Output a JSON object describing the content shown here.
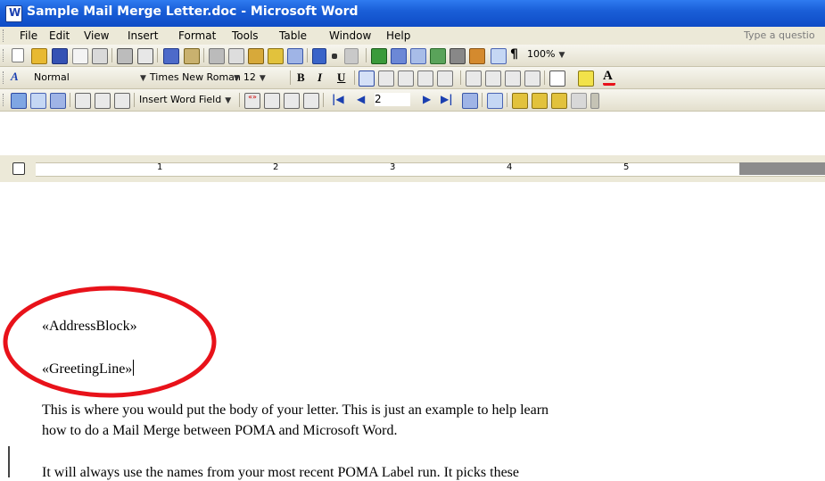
{
  "window": {
    "title": "Sample Mail Merge Letter.doc - Microsoft Word"
  },
  "menu": {
    "items": [
      "File",
      "Edit",
      "View",
      "Insert",
      "Format",
      "Tools",
      "Table",
      "Window",
      "Help"
    ],
    "ask_placeholder": "Type a questio"
  },
  "formatting": {
    "style": "Normal",
    "font": "Times New Roman",
    "size": "12",
    "bold": "B",
    "italic": "I",
    "underline": "U",
    "zoom": "100%"
  },
  "mail_merge": {
    "insert_word_field": "Insert Word Field",
    "record_number": "2"
  },
  "ruler": {
    "numbers": [
      "1",
      "2",
      "3",
      "4",
      "5"
    ]
  },
  "document": {
    "address_block": "«AddressBlock»",
    "greeting_line": "«GreetingLine»",
    "paragraph1_line1": "This is where you would put the body of your letter. This is just an example to help learn",
    "paragraph1_line2": "how to do a Mail Merge between POMA and Microsoft Word.",
    "paragraph2_line1": "It will always use the names from your most recent POMA Label run. It picks these"
  },
  "annotation": {
    "circle_color": "#e8121a"
  }
}
